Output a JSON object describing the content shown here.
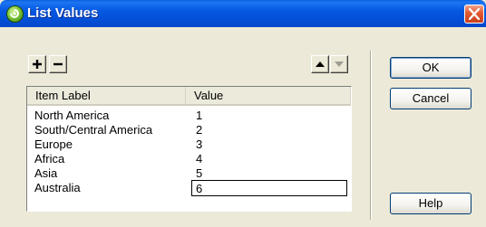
{
  "window": {
    "title": "List Values"
  },
  "icons": {
    "app": "dreamweaver-app-icon",
    "close": "close-icon",
    "add": "plus-icon",
    "remove": "minus-icon",
    "up": "arrow-up-icon",
    "down": "arrow-down-icon"
  },
  "colors": {
    "titlebar": "#0450d8",
    "close": "#e2582f",
    "dialog_bg": "#ece9d8"
  },
  "toolbar": {
    "add": "+",
    "remove": "−"
  },
  "grid": {
    "columns": [
      "Item Label",
      "Value"
    ],
    "rows": [
      {
        "label": "North America",
        "value": "1"
      },
      {
        "label": "South/Central America",
        "value": "2"
      },
      {
        "label": "Europe",
        "value": "3"
      },
      {
        "label": "Africa",
        "value": "4"
      },
      {
        "label": "Asia",
        "value": "5"
      },
      {
        "label": "Australia",
        "value": "6"
      }
    ]
  },
  "buttons": {
    "ok": "OK",
    "cancel": "Cancel",
    "help": "Help"
  }
}
